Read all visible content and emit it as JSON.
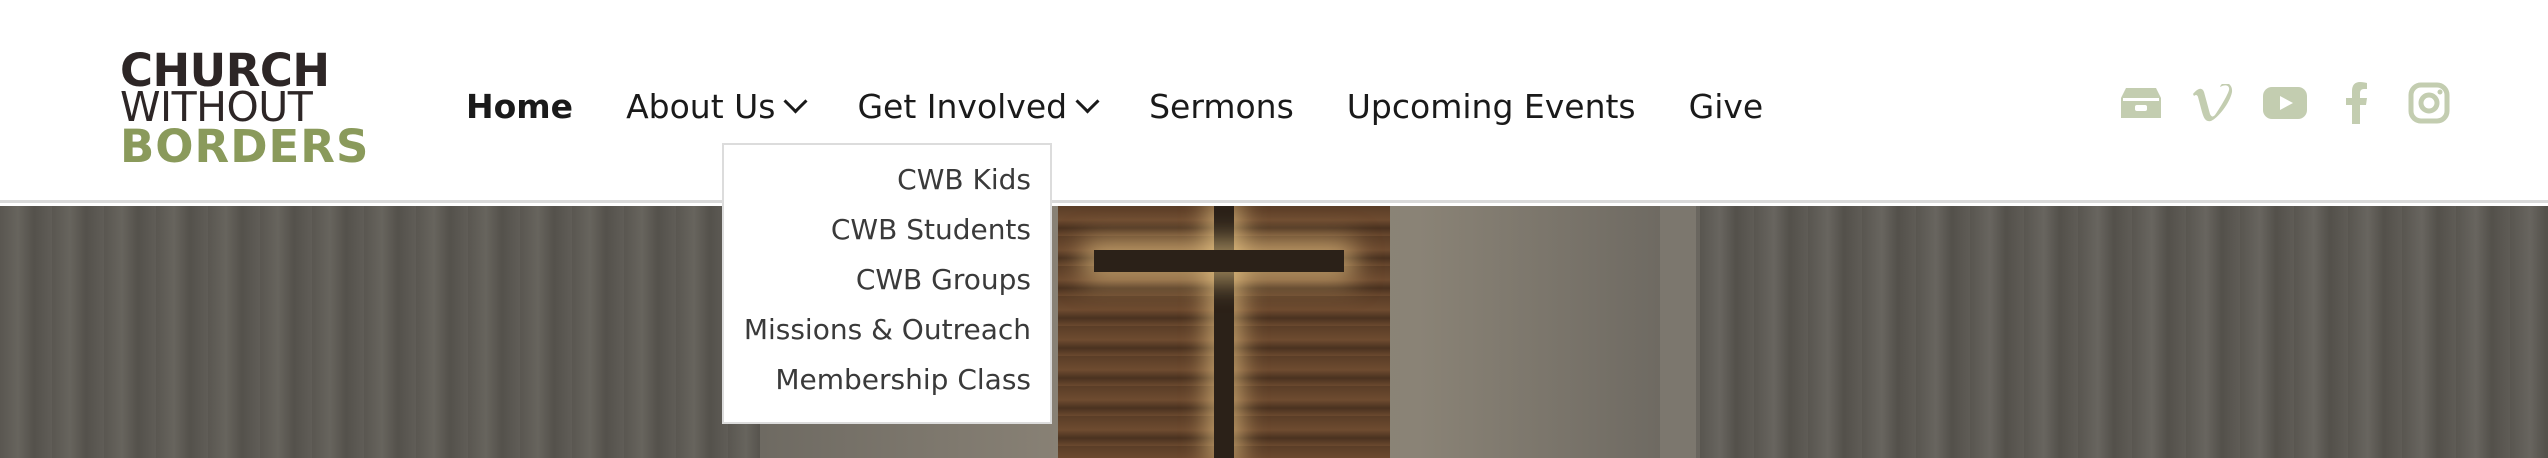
{
  "logo": {
    "line1": "CHURCH",
    "line2": "WITHOUT",
    "line3": "BORDERS"
  },
  "nav": {
    "items": [
      {
        "label": "Home",
        "active": true
      },
      {
        "label": "About Us",
        "dropdown": true
      },
      {
        "label": "Get Involved",
        "dropdown": true,
        "open": true
      },
      {
        "label": "Sermons"
      },
      {
        "label": "Upcoming Events"
      },
      {
        "label": "Give"
      }
    ]
  },
  "dropdown": {
    "items": [
      "CWB Kids",
      "CWB Students",
      "CWB Groups",
      "Missions & Outreach",
      "Membership Class"
    ]
  },
  "social": {
    "icons": [
      "tithely-icon",
      "vimeo-icon",
      "youtube-icon",
      "facebook-icon",
      "instagram-icon"
    ]
  },
  "colors": {
    "brand_dark": "#2d2626",
    "brand_green": "#8a9a5b",
    "social_icon": "#c3cdb0",
    "nav_text": "#1a1a1a"
  }
}
